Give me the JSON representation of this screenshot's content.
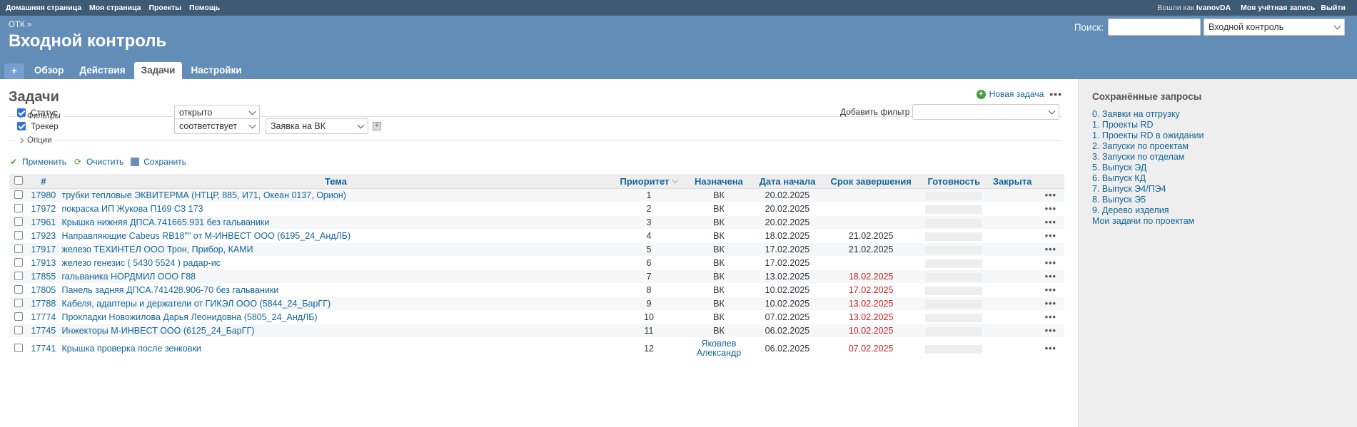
{
  "top_menu": {
    "left": [
      "Домашняя страница",
      "Моя страница",
      "Проекты",
      "Помощь"
    ],
    "logged_as_prefix": "Вошли как",
    "username": "IvanovDA",
    "account": "Моя учётная запись",
    "logout": "Выйти"
  },
  "header": {
    "parent": "ОТК »",
    "title": "Входной контроль",
    "search_label": "Поиск:",
    "search_value": "",
    "project_jump": "Входной контроль"
  },
  "tabs": [
    "+",
    "Обзор",
    "Действия",
    "Задачи",
    "Настройки"
  ],
  "page": {
    "title": "Задачи",
    "new_issue": "Новая задача",
    "more": "•••"
  },
  "filters": {
    "legend": "Фильтры",
    "status_label": "Статус",
    "status_op": "открыто",
    "tracker_label": "Трекер",
    "tracker_op": "соответствует",
    "tracker_value": "Заявка на ВК",
    "add_filter_label": "Добавить фильтр",
    "add_filter_value": "",
    "options_legend": "Опции"
  },
  "actions": {
    "apply": "Применить",
    "clear": "Очистить",
    "save": "Сохранить"
  },
  "table": {
    "headers": {
      "id": "#",
      "subject": "Тема",
      "priority": "Приоритет",
      "assigned": "Назначена",
      "start": "Дата начала",
      "due": "Срок завершения",
      "done": "Готовность",
      "closed": "Закрыта"
    },
    "rows": [
      {
        "id": "17980",
        "subject": "трубки тепловые ЭКВИТЕРМА (НТЦР, 885, И71, Океан 0137, Орион)",
        "priority": "1",
        "assigned": "ВК",
        "start": "20.02.2025",
        "due": "",
        "overdue": false,
        "done": 0
      },
      {
        "id": "17972",
        "subject": "покраска ИП Жукова П169 СЗ 173",
        "priority": "2",
        "assigned": "ВК",
        "start": "20.02.2025",
        "due": "",
        "overdue": false,
        "done": 0
      },
      {
        "id": "17961",
        "subject": "Крышка нижняя ДПСА.741665.931 без гальваники",
        "priority": "3",
        "assigned": "ВК",
        "start": "20.02.2025",
        "due": "",
        "overdue": false,
        "done": 0
      },
      {
        "id": "17923",
        "subject": "Направляющие Cabeus RB18\"\" от М-ИНВЕСТ ООО (6195_24_АндЛБ)",
        "priority": "4",
        "assigned": "ВК",
        "start": "18.02.2025",
        "due": "21.02.2025",
        "overdue": false,
        "done": 0
      },
      {
        "id": "17917",
        "subject": "железо ТЕХИНТЕЛ ООО Трон, Прибор, КАМИ",
        "priority": "5",
        "assigned": "ВК",
        "start": "17.02.2025",
        "due": "21.02.2025",
        "overdue": false,
        "done": 0
      },
      {
        "id": "17913",
        "subject": "железо генезис ( 5430 5524 ) радар-ис",
        "priority": "6",
        "assigned": "ВК",
        "start": "17.02.2025",
        "due": "",
        "overdue": false,
        "done": 0
      },
      {
        "id": "17855",
        "subject": "гальваника НОРДМИЛ ООО Г88",
        "priority": "7",
        "assigned": "ВК",
        "start": "13.02.2025",
        "due": "18.02.2025",
        "overdue": true,
        "done": 0
      },
      {
        "id": "17805",
        "subject": "Панель задняя ДПСА.741428.906-70 без гальваники",
        "priority": "8",
        "assigned": "ВК",
        "start": "10.02.2025",
        "due": "17.02.2025",
        "overdue": true,
        "done": 0
      },
      {
        "id": "17788",
        "subject": "Кабеля, адаптеры и держатели от ГИКЭЛ ООО (5844_24_БарГГ)",
        "priority": "9",
        "assigned": "ВК",
        "start": "10.02.2025",
        "due": "13.02.2025",
        "overdue": true,
        "done": 0
      },
      {
        "id": "17774",
        "subject": "Прокладки Новожилова Дарья Леонидовна (5805_24_АндЛБ)",
        "priority": "10",
        "assigned": "ВК",
        "start": "07.02.2025",
        "due": "13.02.2025",
        "overdue": true,
        "done": 0
      },
      {
        "id": "17745",
        "subject": "Инжекторы М-ИНВЕСТ ООО (6125_24_БарГГ)",
        "priority": "11",
        "assigned": "ВК",
        "start": "06.02.2025",
        "due": "10.02.2025",
        "overdue": true,
        "done": 0
      },
      {
        "id": "17741",
        "subject": "Крышка проверка после зенковки",
        "priority": "12",
        "assigned": "Яковлев Александр",
        "start": "06.02.2025",
        "due": "07.02.2025",
        "overdue": true,
        "done": 0
      }
    ]
  },
  "sidebar": {
    "title": "Сохранённые запросы",
    "queries": [
      "0. Заявки на отгрузку",
      "1. Проекты RD",
      "1. Проекты RD в ожидании",
      "2. Запуски по проектам",
      "3. Запуски по отделам",
      "5. Выпуск ЭД",
      "6. Выпуск КД",
      "7. Выпуск Э4/ПЭ4",
      "8. Выпуск Э5",
      "9. Дерево изделия",
      "Мои задачи по проектам"
    ]
  },
  "colors": {
    "top_menu": "#3e5b76",
    "header": "#628db6",
    "link": "#169",
    "overdue": "#c22"
  }
}
